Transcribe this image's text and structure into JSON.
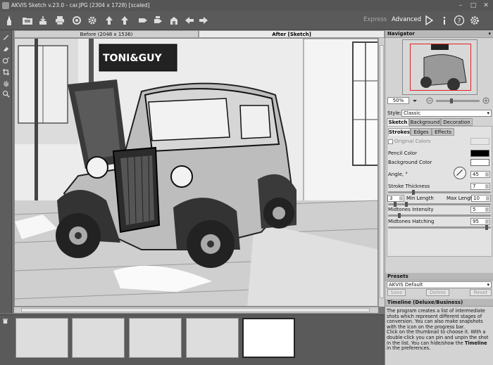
{
  "title": "AKVIS Sketch v.23.0 - car.JPG (2304 x 1728) [scaled]",
  "window_buttons": [
    "–",
    "□",
    "✕"
  ],
  "toolbar": {
    "icons": [
      "open-icon",
      "save-icon",
      "print-icon",
      "batch-icon",
      "share-icon",
      "import-icon",
      "export-icon",
      "preset-icon",
      "snapshot-icon",
      "undo-icon",
      "redo-icon"
    ],
    "mode_express": "Express",
    "mode_advanced": "Advanced",
    "right_icons": [
      "run-icon",
      "info-icon",
      "help-icon",
      "settings-icon"
    ]
  },
  "canvas": {
    "before_tab": "Before (2048 x 1536)",
    "after_tab": "After [Sketch]",
    "sign_text": "TONI&GUY"
  },
  "navigator": {
    "header": "Navigator",
    "zoom": "50%"
  },
  "style": {
    "label": "Style:",
    "value": "Classic"
  },
  "tabs": [
    "Sketch",
    "Background",
    "Decoration"
  ],
  "subtabs": [
    "Strokes",
    "Edges",
    "Effects"
  ],
  "params": {
    "original_colors": "Original Colors",
    "pencil_color": "Pencil Color",
    "background_color": "Background Color",
    "angle_label": "Angle, °",
    "angle_value": "45",
    "stroke_thickness_label": "Stroke Thickness",
    "stroke_thickness_value": "7",
    "min_length_value": "3",
    "min_length_label": "Min Length",
    "max_length_label": "Max Length",
    "max_length_value": "10",
    "midtones_intensity_label": "Midtones Intensity",
    "midtones_intensity_value": "5",
    "midtones_hatching_label": "Midtones Hatching",
    "midtones_hatching_value": "95"
  },
  "presets": {
    "header": "Presets",
    "value": "AKVIS Default",
    "save": "Save",
    "delete": "Delete",
    "reset": "Reset"
  },
  "timeline": {
    "header": "Timeline (Deluxe/Business)",
    "text_1": "The program creates a list of intermediate shots which represent different stages of conversion. You can also make snapshots with the icon on the progress bar.",
    "text_2_a": "Click on the thumbnail to choose it. With a double-click you can pin and unpin the shot in the list. You can hide/show the ",
    "text_2_b": "Timeline",
    "text_2_c": " in the preferences."
  }
}
